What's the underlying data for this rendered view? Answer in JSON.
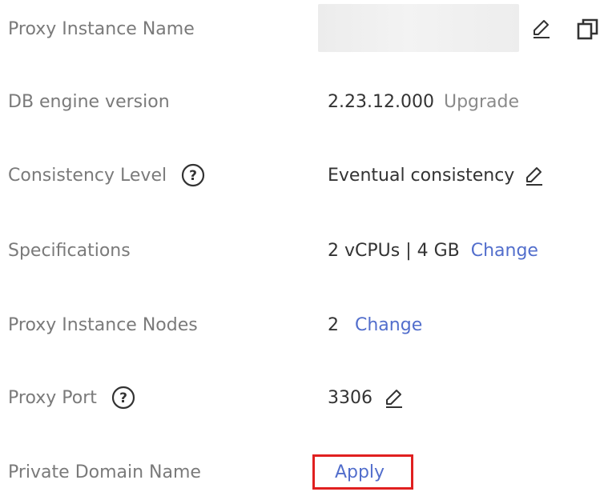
{
  "rows": {
    "proxy_instance_name": {
      "label": "Proxy Instance Name",
      "value": ""
    },
    "db_engine_version": {
      "label": "DB engine version",
      "value": "2.23.12.000",
      "action": "Upgrade"
    },
    "consistency_level": {
      "label": "Consistency Level",
      "value": "Eventual consistency"
    },
    "specifications": {
      "label": "Specifications",
      "value": "2 vCPUs | 4 GB",
      "action": "Change"
    },
    "proxy_instance_nodes": {
      "label": "Proxy Instance Nodes",
      "value": "2",
      "action": "Change"
    },
    "proxy_port": {
      "label": "Proxy Port",
      "value": "3306"
    },
    "private_domain_name": {
      "label": "Private Domain Name",
      "action": "Apply"
    }
  },
  "colors": {
    "label": "#7a7a7a",
    "value": "#333333",
    "link": "#526ecc",
    "highlight_border": "#e02020"
  },
  "icons": {
    "edit": "pencil-edit-icon",
    "copy": "copy-icon",
    "help": "question-circle-icon"
  }
}
